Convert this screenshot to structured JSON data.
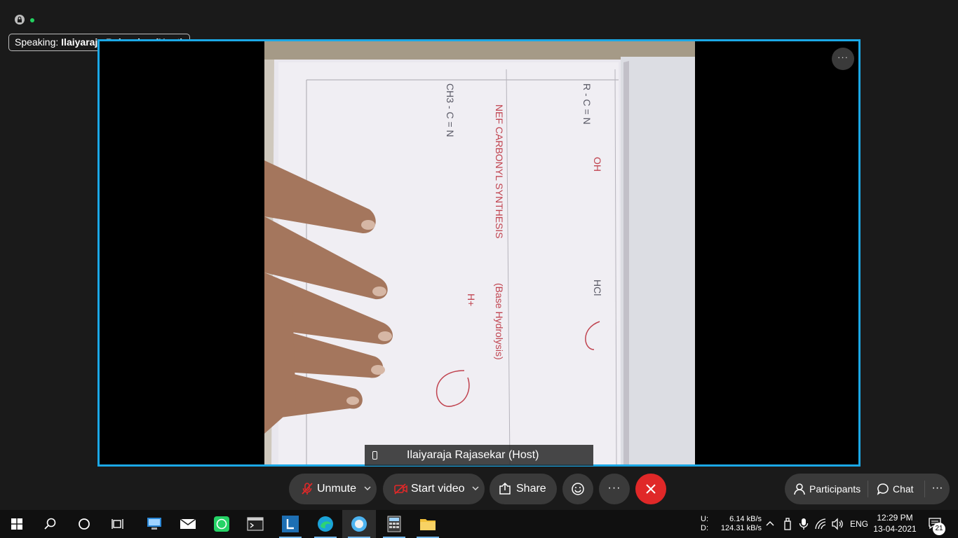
{
  "meeting": {
    "speaking_prefix": "Speaking:",
    "speaking_name": "Ilaiyaraja Rajasekar (Host)",
    "more_label": "···",
    "participant_name": "Ilaiyaraja Rajasekar  (Host)",
    "accent_color": "#1ba8e6"
  },
  "notebook": {
    "lines": [
      "NEF CARBONYL SYNTHESIS",
      "(Base Hydrolysis)",
      "CH3 - C = N",
      "R - C = N",
      "HCl",
      "OH",
      "H+"
    ]
  },
  "controls": {
    "unmute": "Unmute",
    "start_video": "Start video",
    "share": "Share",
    "reactions_icon": "smile-icon",
    "more": "···",
    "participants": "Participants",
    "chat": "Chat",
    "overflow": "···"
  },
  "taskbar": {
    "net_upload_label": "U:",
    "net_download_label": "D:",
    "net_upload_value": "6.14 kB/s",
    "net_download_value": "124.31 kB/s",
    "language": "ENG",
    "time": "12:29 PM",
    "date": "13-04-2021",
    "notification_count": "21"
  }
}
